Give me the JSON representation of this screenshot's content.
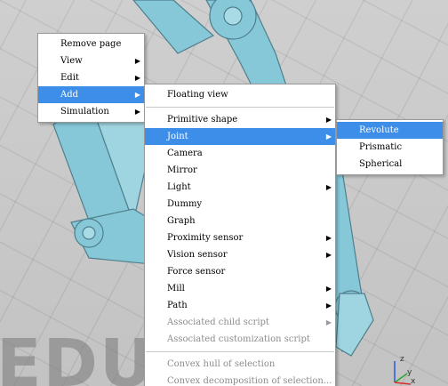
{
  "watermark": "EDU",
  "axis": {
    "z": "z",
    "y": "y",
    "x": "x"
  },
  "menus": {
    "main": [
      {
        "label": "Remove page",
        "submenu": false,
        "highlight": false
      },
      {
        "label": "View",
        "submenu": true,
        "highlight": false
      },
      {
        "label": "Edit",
        "submenu": true,
        "highlight": false
      },
      {
        "label": "Add",
        "submenu": true,
        "highlight": true
      },
      {
        "label": "Simulation",
        "submenu": true,
        "highlight": false
      }
    ],
    "add": [
      {
        "label": "Floating view",
        "submenu": false
      },
      {
        "label": "Primitive shape",
        "submenu": true
      },
      {
        "label": "Joint",
        "submenu": true,
        "highlight": true
      },
      {
        "label": "Camera",
        "submenu": false
      },
      {
        "label": "Mirror",
        "submenu": false
      },
      {
        "label": "Light",
        "submenu": true
      },
      {
        "label": "Dummy",
        "submenu": false
      },
      {
        "label": "Graph",
        "submenu": false
      },
      {
        "label": "Proximity sensor",
        "submenu": true
      },
      {
        "label": "Vision sensor",
        "submenu": true
      },
      {
        "label": "Force sensor",
        "submenu": false
      },
      {
        "label": "Mill",
        "submenu": true
      },
      {
        "label": "Path",
        "submenu": true
      },
      {
        "label": "Associated child script",
        "submenu": true,
        "disabled": true
      },
      {
        "label": "Associated customization script",
        "submenu": false,
        "disabled": true
      },
      {
        "label": "Convex hull of selection",
        "submenu": false,
        "disabled": true
      },
      {
        "label": "Convex decomposition of selection...",
        "submenu": false,
        "disabled": true
      }
    ],
    "joint": [
      {
        "label": "Revolute",
        "highlight": true
      },
      {
        "label": "Prismatic"
      },
      {
        "label": "Spherical"
      }
    ]
  },
  "colors": {
    "highlight": "#3d8ee8",
    "robot_link": "#86c8d8",
    "robot_edge": "#4f7f8c"
  }
}
